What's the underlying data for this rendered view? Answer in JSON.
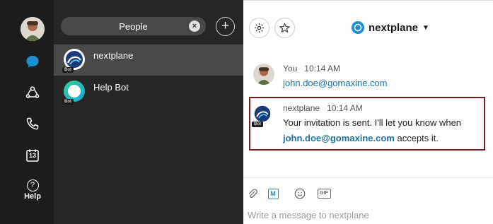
{
  "nav": {
    "help_label": "Help",
    "calendar_day": "13"
  },
  "list": {
    "filter_label": "People",
    "clear_glyph": "×",
    "add_glyph": "+",
    "items": [
      {
        "name": "nextplane",
        "badge": "Bot",
        "selected": true
      },
      {
        "name": "Help Bot",
        "badge": "Bot",
        "selected": false
      }
    ]
  },
  "header": {
    "space_name": "nextplane",
    "settings_icon": "gear-icon",
    "favorite_icon": "star-icon"
  },
  "messages": [
    {
      "sender": "You",
      "time": "10:14 AM",
      "text": "john.doe@gomaxine.com"
    },
    {
      "sender": "nextplane",
      "time": "10:14 AM",
      "badge": "Bot",
      "text_line1": "Your invitation is sent. I'll let you know when",
      "text_line2_link": "john.doe@gomaxine.com",
      "text_line2_rest": " accepts it."
    }
  ],
  "composer": {
    "placeholder": "Write a message to nextplane",
    "gif_label": "GIF",
    "markdown_label": "M"
  },
  "colors": {
    "rail_bg": "#1d1d1d",
    "list_bg": "#262626",
    "active_row": "#494949",
    "accent_blue": "#1b8fd0",
    "link": "#1a73a8",
    "highlight_border": "#7d1a1a"
  }
}
